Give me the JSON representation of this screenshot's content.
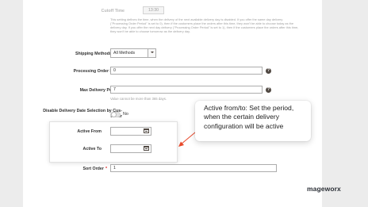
{
  "form": {
    "cutoff_time": {
      "label": "Cutoff Time",
      "value": "13:30"
    },
    "cutoff_note": "This setting defines the time, when the delivery of the next available delivery day is disabled. If you offer the same day delivery (\"Processing Order Period\" is set to 0), then if the customers place the orders after this time, they won't be able to choose today as the delivery day. If you offer the next day delivery (\"Processing Order Period\" is set to 1), then if the customers place the orders after this time, they won't be able to choose tomorrow as the delivery day.",
    "shipping_methods_limit": {
      "label": "Shipping Methods Limit",
      "value": "All Methods"
    },
    "processing_order_period": {
      "label": "Processing Order Period",
      "value": "0"
    },
    "max_delivery_period": {
      "label": "Max Delivery Period",
      "value": "7",
      "note": "Value cannot be more than 365 days."
    },
    "disable_date_selection": {
      "label_line1": "Disable Delivery Date Selection by Cus-",
      "label_line2": "tomer",
      "value": "No"
    },
    "active_from": {
      "label": "Active From",
      "value": ""
    },
    "active_to": {
      "label": "Active To",
      "value": ""
    },
    "sort_order": {
      "label": "Sort Order",
      "value": "1"
    },
    "required_mark": "*",
    "help_glyph": "?"
  },
  "callout": {
    "text": "Active from/to: Set the period, when the certain delivery configuration will be active",
    "arrow_color": "#e8492b"
  },
  "brand": {
    "logo_text": "mageworx"
  }
}
